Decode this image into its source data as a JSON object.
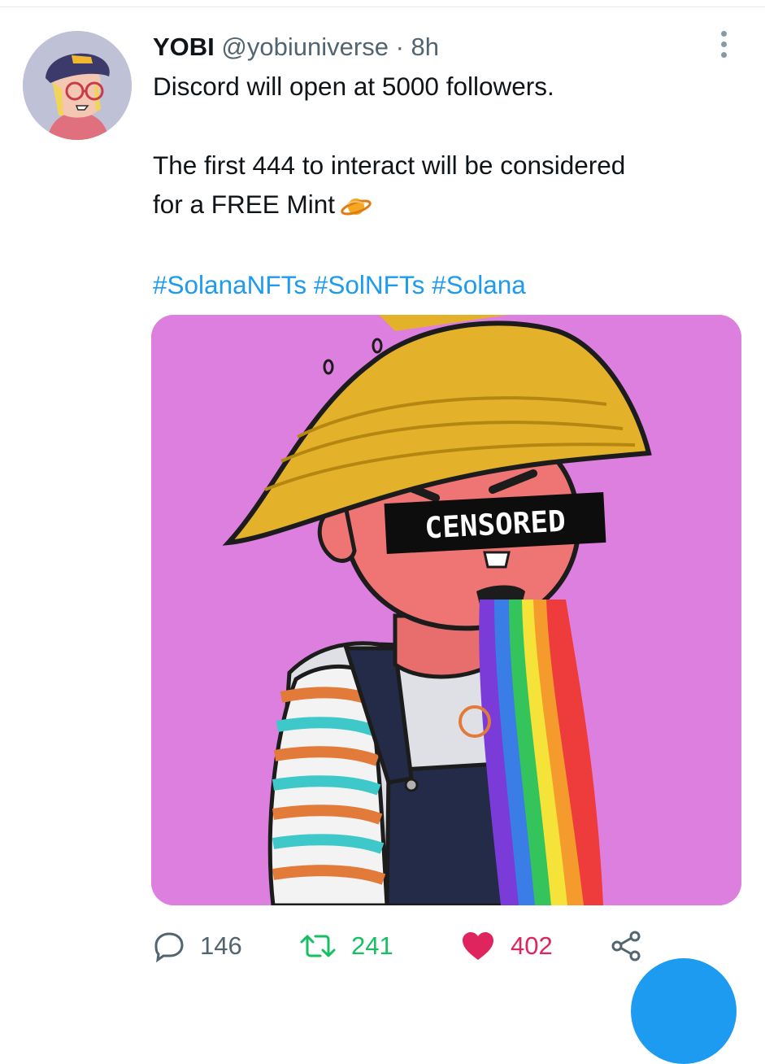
{
  "tweet": {
    "author_name": "YOBI",
    "handle": "@yobiuniverse",
    "separator": "·",
    "time": "8h",
    "text_line_1": "Discord will open at 5000 followers.",
    "text_line_2": "The first 444 to interact will be considered",
    "text_line_3": "for a FREE Mint",
    "hashtags": [
      "#SolanaNFTs",
      "#SolNFTs",
      "#Solana"
    ],
    "media_caption": "CENSORED",
    "replies": "146",
    "retweets": "241",
    "likes": "402"
  },
  "colors": {
    "accent": "#1d9bf0",
    "retweet": "#17bf63",
    "like": "#e0245e",
    "media_bg": "#dd7fdf"
  },
  "icons": [
    "more-icon",
    "planet-emoji-icon",
    "reply-icon",
    "retweet-icon",
    "like-icon",
    "share-icon"
  ]
}
